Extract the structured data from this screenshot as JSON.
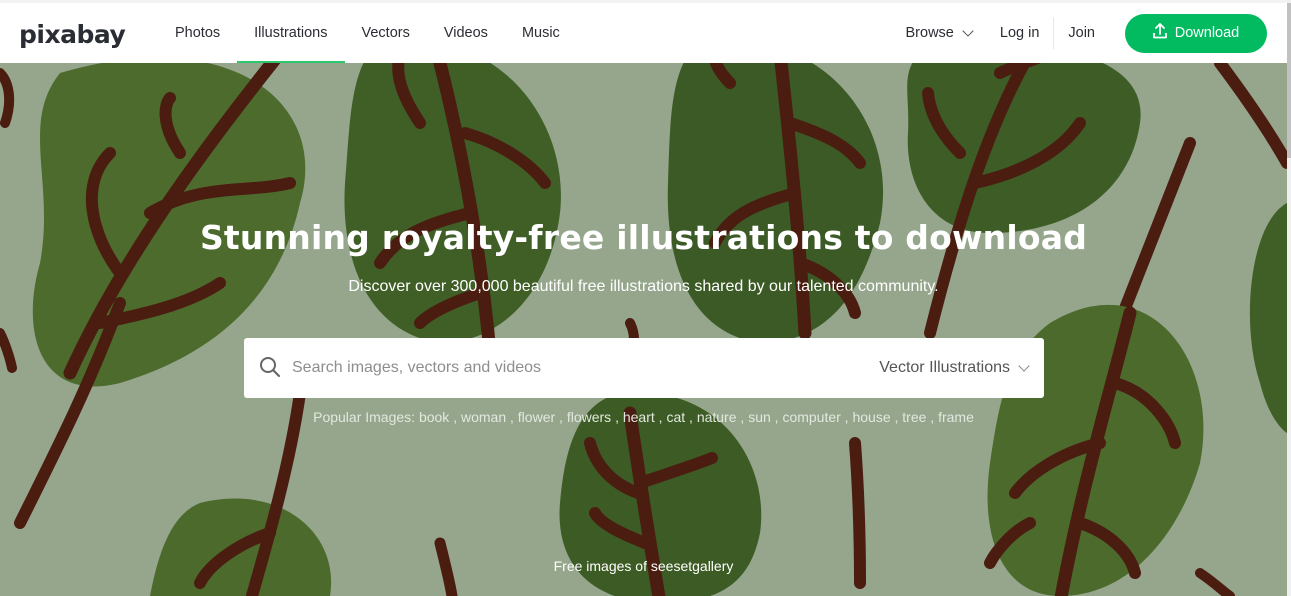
{
  "brand": {
    "logo": "pixabay",
    "accent": "#02bb61"
  },
  "nav": {
    "items": [
      {
        "label": "Photos",
        "active": false
      },
      {
        "label": "Illustrations",
        "active": true
      },
      {
        "label": "Vectors",
        "active": false
      },
      {
        "label": "Videos",
        "active": false
      },
      {
        "label": "Music",
        "active": false
      }
    ]
  },
  "right_nav": {
    "browse": "Browse",
    "login": "Log in",
    "join": "Join",
    "download": "Download"
  },
  "hero": {
    "title": "Stunning royalty-free illustrations to download",
    "subtitle": "Discover over 300,000 beautiful free illustrations shared by our talented community.",
    "background_color": "#95a68c",
    "credit": "Free images of seesetgallery"
  },
  "search": {
    "placeholder": "Search images, vectors and videos",
    "value": "",
    "type_selected": "Vector Illustrations"
  },
  "popular": {
    "label": "Popular Images:",
    "tags": [
      "book",
      "woman",
      "flower",
      "flowers",
      "heart",
      "cat",
      "nature",
      "sun",
      "computer",
      "house",
      "tree",
      "frame"
    ]
  }
}
